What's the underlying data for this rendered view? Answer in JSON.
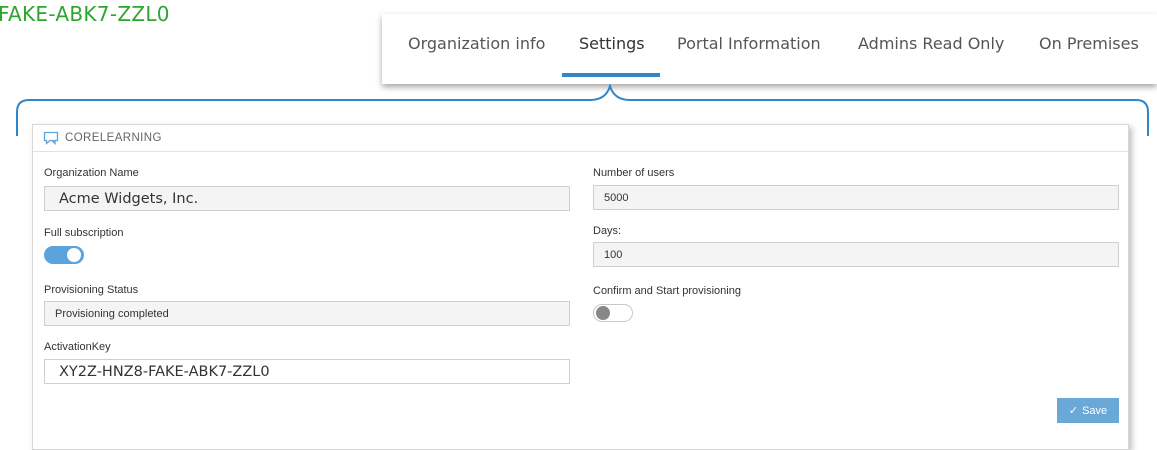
{
  "top_key": "FAKE-ABK7-ZZL0",
  "tabs": [
    {
      "label": "Organization info",
      "active": false
    },
    {
      "label": "Settings",
      "active": true
    },
    {
      "label": "Portal Information",
      "active": false
    },
    {
      "label": "Admins Read Only",
      "active": false
    },
    {
      "label": "On Premises",
      "active": false
    }
  ],
  "panel": {
    "title": "CORELEARNING",
    "icon": "chat-bubble-icon",
    "organization_name": {
      "label": "Organization Name",
      "value": "Acme Widgets, Inc."
    },
    "full_subscription": {
      "label": "Full subscription",
      "enabled": true
    },
    "provisioning_status": {
      "label": "Provisioning Status",
      "value": "Provisioning completed"
    },
    "activation_key": {
      "label": "ActivationKey",
      "value": "XY2Z-HNZ8-FAKE-ABK7-ZZL0"
    },
    "number_of_users": {
      "label": "Number of users",
      "value": "5000"
    },
    "days": {
      "label": "Days:",
      "value": "100"
    },
    "confirm_provisioning": {
      "label": "Confirm and Start provisioning",
      "enabled": false
    },
    "save_label": "Save"
  },
  "colors": {
    "accent": "#2f86c8",
    "toggle_on": "#5aa3dc",
    "save_button": "#6aa8d8",
    "key_text": "#2ea52e"
  }
}
